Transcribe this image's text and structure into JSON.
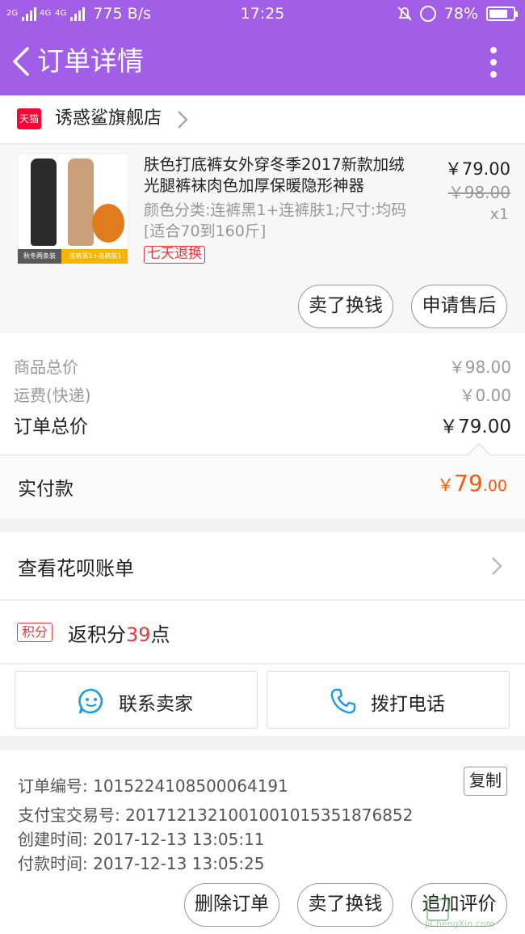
{
  "status_bar": {
    "network": "2G",
    "network2": "4G",
    "network3": "4G",
    "speed": "775 B/s",
    "time": "17:25",
    "battery": "78%",
    "battery_level": 0.78
  },
  "navbar": {
    "title": "订单详情"
  },
  "shop": {
    "badge": "天猫",
    "name": "诱惑鲨旗舰店"
  },
  "product": {
    "image_caption_left": "秋冬两条装",
    "image_caption_right": "连裤黑1+连裤肤1",
    "title": "肤色打底裤女外穿冬季2017新款加绒光腿裤袜肉色加厚保暖隐形神器",
    "sku": "颜色分类:连裤黑1+连裤肤1;尺寸:均码[适合70到160斤]",
    "tag": "七天退换",
    "price": "￥79.00",
    "original_price": "￥98.00",
    "quantity": "x1",
    "sell_button": "卖了换钱",
    "aftersale_button": "申请售后"
  },
  "summary": {
    "goods_label": "商品总价",
    "goods_value": "￥98.00",
    "shipping_label": "运费(快递)",
    "shipping_value": "￥0.00",
    "total_label": "订单总价",
    "total_value": "￥79.00",
    "paid_label": "实付款",
    "paid_currency": "￥",
    "paid_int": "79",
    "paid_dec": ".00"
  },
  "huabei": {
    "label": "查看花呗账单"
  },
  "points": {
    "badge": "积分",
    "prefix": "返积分",
    "value": "39",
    "suffix": "点"
  },
  "contact": {
    "seller": "联系卖家",
    "phone": "拨打电话"
  },
  "order_info": {
    "order_no": "订单编号: 1015224108500064191",
    "copy": "复制",
    "alipay_no": "支付宝交易号: 2017121321001001015351876852",
    "created": "创建时间: 2017-12-13 13:05:11",
    "paid": "付款时间: 2017-12-13 13:05:25"
  },
  "bottom_actions": {
    "delete": "删除订单",
    "sell": "卖了换钱",
    "review": "追加评价"
  },
  "watermark": "JiChengXin.com",
  "colors": {
    "brand_purple": "#a25ee6",
    "price_orange": "#f55b0b",
    "tag_red": "#e4393c",
    "tmall_red": "#ff0036",
    "icon_blue": "#1e9be8"
  }
}
